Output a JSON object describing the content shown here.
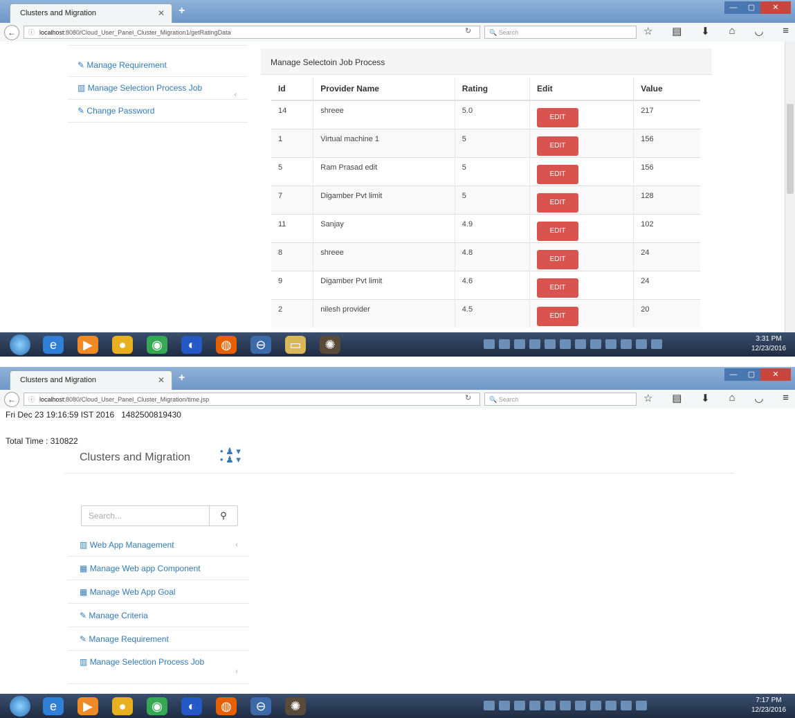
{
  "shot1": {
    "tab_title": "Clusters and Migration",
    "url_host": "localhost",
    "url_rest": ":8080/Cloud_User_Panel_Cluster_Migration1/getRatingData",
    "search_placeholder": "Search",
    "sidebar": [
      {
        "label": "Manage Requirement",
        "icon": "edit-icon"
      },
      {
        "label": "Manage Selection Process Job",
        "icon": "bar-chart-icon"
      },
      {
        "label": "Change Password",
        "icon": "edit-icon"
      }
    ],
    "panel_title": "Manage Selectoin Job Process",
    "table": {
      "headers": [
        "Id",
        "Provider Name",
        "Rating",
        "Edit",
        "Value"
      ],
      "edit_label": "EDIT",
      "rows": [
        {
          "id": "14",
          "name": "shreee",
          "rating": "5.0",
          "value": "217"
        },
        {
          "id": "1",
          "name": "Virtual machine 1",
          "rating": "5",
          "value": "156"
        },
        {
          "id": "5",
          "name": "Ram Prasad edit",
          "rating": "5",
          "value": "156"
        },
        {
          "id": "7",
          "name": "Digamber Pvt limit",
          "rating": "5",
          "value": "128"
        },
        {
          "id": "11",
          "name": "Sanjay",
          "rating": "4.9",
          "value": "102"
        },
        {
          "id": "8",
          "name": "shreee",
          "rating": "4.8",
          "value": "24"
        },
        {
          "id": "9",
          "name": "Digamber Pvt limit",
          "rating": "4.6",
          "value": "24"
        },
        {
          "id": "2",
          "name": "nilesh provider",
          "rating": "4.5",
          "value": "20"
        }
      ]
    },
    "clock_time": "3:31 PM",
    "clock_date": "12/23/2016"
  },
  "shot2": {
    "tab_title": "Clusters and Migration",
    "url_host": "localhost",
    "url_rest": ":8080/Cloud_User_Panel_Cluster_Migration/time.jsp",
    "search_placeholder": "Search",
    "timestamp_line": "Fri Dec 23 19:16:59 IST 2016   1482500819430",
    "total_time_line": "Total Time : 310822",
    "brand": "Clusters and Migration",
    "sidebar_search_placeholder": "Search...",
    "sidebar": [
      {
        "label": "Web App Management",
        "icon": "bar-chart-icon",
        "chevron": true
      },
      {
        "label": "Manage Web app Component",
        "icon": "grid-icon"
      },
      {
        "label": "Manage Web App Goal",
        "icon": "grid-icon"
      },
      {
        "label": "Manage Criteria",
        "icon": "edit-icon"
      },
      {
        "label": "Manage Requirement",
        "icon": "edit-icon"
      },
      {
        "label": "Manage Selection Process Job",
        "icon": "bar-chart-icon",
        "chevron": true
      }
    ],
    "clock_time": "7:17 PM",
    "clock_date": "12/23/2016"
  }
}
